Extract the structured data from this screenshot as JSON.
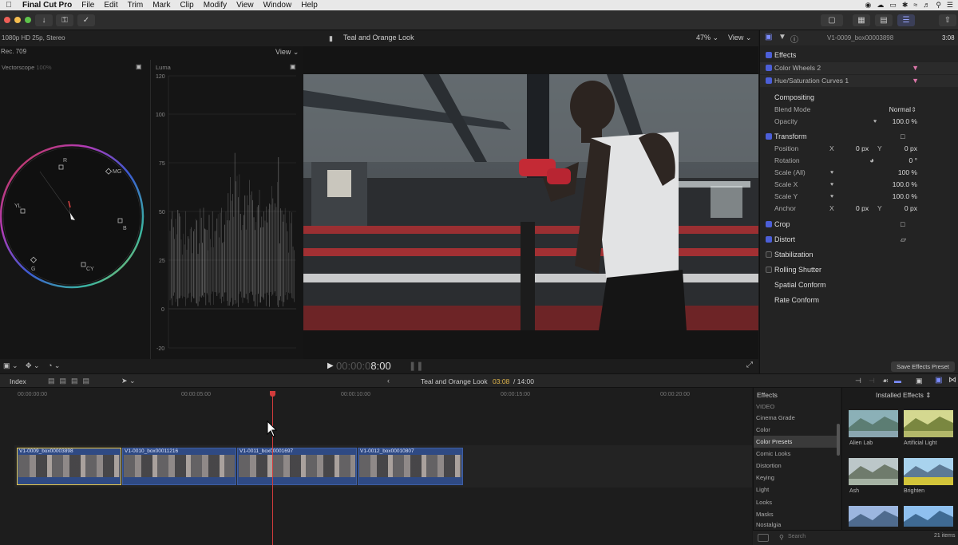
{
  "menubar": {
    "app": "Final Cut Pro",
    "items": [
      "File",
      "Edit",
      "Trim",
      "Mark",
      "Clip",
      "Modify",
      "View",
      "Window",
      "Help"
    ]
  },
  "viewer": {
    "format": "1080p HD 25p, Stereo",
    "title": "Teal and Orange Look",
    "zoom": "47%",
    "view_label": "View"
  },
  "scopes": {
    "colorspace": "Rec. 709",
    "view_label": "View",
    "vectorscope_title": "Vectorscope",
    "vectorscope_pct": "100%",
    "vectorscope_targets": [
      "R",
      "MG",
      "B",
      "CY",
      "G",
      "YL"
    ],
    "luma_title": "Luma",
    "luma_ticks": [
      "120",
      "100",
      "75",
      "50",
      "25",
      "0",
      "-20"
    ]
  },
  "transport": {
    "timecode_dim": "00:00:0",
    "timecode_bright": "8:00"
  },
  "inspector": {
    "clip_name": "V1-0009_box00003898",
    "duration": "3:08",
    "effects_header": "Effects",
    "effects": [
      "Color Wheels 2",
      "Hue/Saturation Curves 1"
    ],
    "compositing": "Compositing",
    "blend_mode_label": "Blend Mode",
    "blend_mode_value": "Normal",
    "opacity_label": "Opacity",
    "opacity_value": "100.0 %",
    "opacity": 1.0,
    "transform": "Transform",
    "position_label": "Position",
    "position_x": "0 px",
    "position_y": "0 px",
    "rotation_label": "Rotation",
    "rotation_value": "0 °",
    "scale_all_label": "Scale (All)",
    "scale_all_value": "100 %",
    "scale_x_label": "Scale X",
    "scale_x_value": "100.0 %",
    "scale_y_label": "Scale Y",
    "scale_y_value": "100.0 %",
    "anchor_label": "Anchor",
    "anchor_x": "0 px",
    "anchor_y": "0 px",
    "axis_x": "X",
    "axis_y": "Y",
    "crop": "Crop",
    "distort": "Distort",
    "stabilization": "Stabilization",
    "rolling_shutter": "Rolling Shutter",
    "spatial_conform": "Spatial Conform",
    "rate_conform": "Rate Conform",
    "save_preset": "Save Effects Preset"
  },
  "timeline": {
    "index_label": "Index",
    "project": "Teal and Orange Look",
    "position": "03:08",
    "total": "/ 14:00",
    "ruler": [
      "00:00:00:00",
      "00:00:05:00",
      "00:00:10:00",
      "00:00:15:00",
      "00:00:20:00"
    ],
    "clips": [
      "V1-0009_box00003898",
      "V1-0010_box00011216",
      "V1-0011_box00001697",
      "V1-0012_box00010807"
    ]
  },
  "effects_browser": {
    "header": "Effects",
    "installed": "Installed Effects",
    "categories": [
      "VIDEO",
      "Cinema Grade",
      "Color",
      "Color Presets",
      "Comic Looks",
      "Distortion",
      "Keying",
      "Light",
      "Looks",
      "Masks",
      "Nostalgia"
    ],
    "selected_category": "Color Presets",
    "thumbnails": [
      "Alien Lab",
      "Artificial Light",
      "Ash",
      "Brighten"
    ],
    "search_placeholder": "Search",
    "item_count": "21 items"
  },
  "colors": {
    "accent": "#4c5fd8",
    "clip": "#2f4a84",
    "selection": "#e8c94b",
    "playhead": "#d23c3c",
    "timecode_accent": "#e0b54a"
  }
}
